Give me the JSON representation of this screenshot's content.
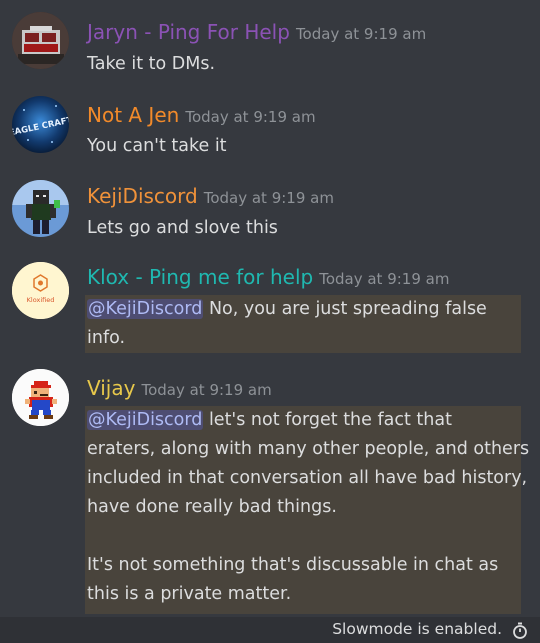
{
  "messages": [
    {
      "username": "Jaryn - Ping For Help",
      "username_color": "#8b52b5",
      "timestamp": "Today at 9:19 am",
      "text": "Take it to DMs.",
      "avatar_icon": "fire-truck-avatar-icon"
    },
    {
      "username": "Not A Jen",
      "username_color": "#f28a2a",
      "timestamp": "Today at 9:19 am",
      "text": "You can't take it",
      "avatar_icon": "eagle-craft-avatar-icon",
      "avatar_text": "EAGLE CRAFT"
    },
    {
      "username": "KejiDiscord",
      "username_color": "#f0923a",
      "timestamp": "Today at 9:19 am",
      "text": "Lets go and slove this",
      "avatar_icon": "minecraft-skin-avatar-icon"
    },
    {
      "username": "Klox - Ping me for help",
      "username_color": "#1fb8b0",
      "timestamp": "Today at 9:19 am",
      "mention": "@KejiDiscord",
      "text_lines": [
        " No, you are just spreading false",
        "info."
      ],
      "avatar_icon": "kloxified-logo-avatar-icon",
      "avatar_text": "Kloxified"
    },
    {
      "username": "Vijay",
      "username_color": "#e7c84b",
      "timestamp": "Today at 9:19 am",
      "mention": "@KejiDiscord",
      "text_lines": [
        " let's not forget the fact that",
        "eraters, along with many other people, and others",
        "included in that conversation all have bad history,",
        "have done really bad things.",
        "",
        "It's not something that's discussable in chat as",
        "this is a private matter."
      ],
      "avatar_icon": "mario-avatar-icon"
    }
  ],
  "footer": {
    "slowmode_text": "Slowmode is enabled.",
    "slowmode_icon": "stopwatch-icon"
  },
  "colors": {
    "background": "#36393f",
    "mention_highlight": "#49443c",
    "mention_text": "#aebaf4",
    "footer_bg": "#2f3136"
  }
}
